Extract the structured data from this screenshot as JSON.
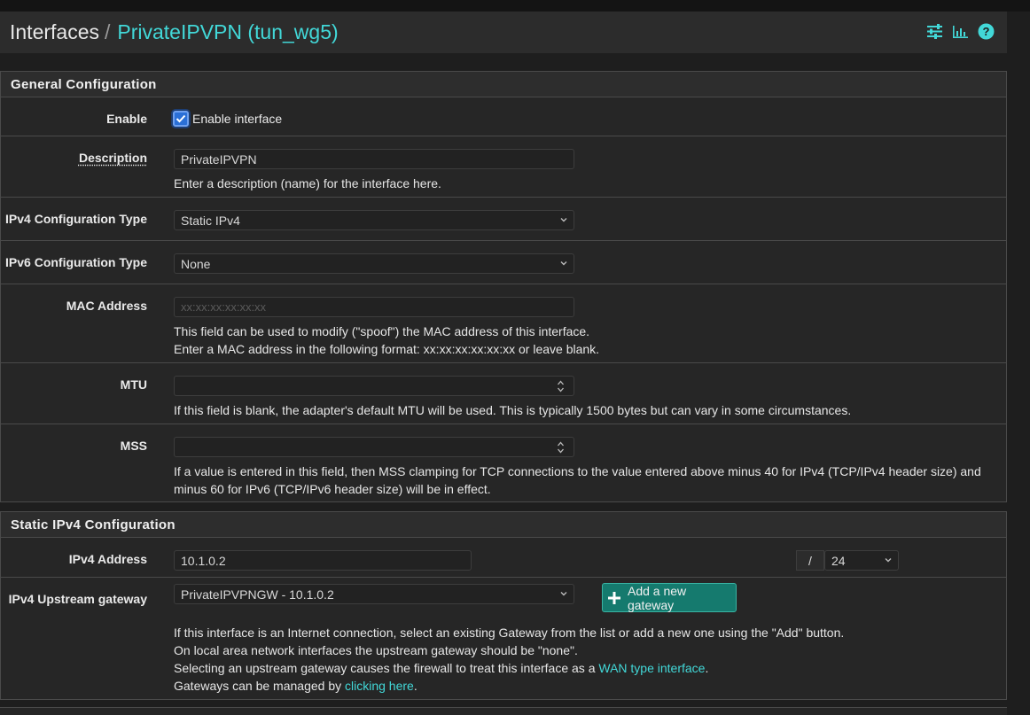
{
  "breadcrumb": {
    "root": "Interfaces",
    "separator": "/",
    "current": "PrivateIPVPN (tun_wg5)"
  },
  "header_icons": [
    "sliders-icon",
    "bar-chart-icon",
    "help-icon"
  ],
  "accent_color": "#42d8d8",
  "general": {
    "title": "General Configuration",
    "enable": {
      "label": "Enable",
      "checkbox_label": "Enable interface",
      "checked": true
    },
    "description": {
      "label": "Description",
      "value": "PrivateIPVPN",
      "help": "Enter a description (name) for the interface here."
    },
    "ipv4_type": {
      "label": "IPv4 Configuration Type",
      "value": "Static IPv4"
    },
    "ipv6_type": {
      "label": "IPv6 Configuration Type",
      "value": "None"
    },
    "mac": {
      "label": "MAC Address",
      "placeholder": "xx:xx:xx:xx:xx:xx",
      "help1": "This field can be used to modify (\"spoof\") the MAC address of this interface.",
      "help2": "Enter a MAC address in the following format: xx:xx:xx:xx:xx:xx or leave blank."
    },
    "mtu": {
      "label": "MTU",
      "value": "",
      "help": "If this field is blank, the adapter's default MTU will be used. This is typically 1500 bytes but can vary in some circumstances."
    },
    "mss": {
      "label": "MSS",
      "value": "",
      "help1": "If a value is entered in this field, then MSS clamping for TCP connections to the value entered above minus 40 for IPv4 (TCP/IPv4 header size) and",
      "help2": "minus 60 for IPv6 (TCP/IPv6 header size) will be in effect."
    }
  },
  "static4": {
    "title": "Static IPv4 Configuration",
    "address": {
      "label": "IPv4 Address",
      "value": "10.1.0.2",
      "slash": "/",
      "cidr": "24"
    },
    "gateway": {
      "label": "IPv4 Upstream gateway",
      "value": "PrivateIPVPNGW - 10.1.0.2",
      "add_button": "Add a new gateway",
      "help1": "If this interface is an Internet connection, select an existing Gateway from the list or add a new one using the \"Add\" button.",
      "help2": "On local area network interfaces the upstream gateway should be \"none\".",
      "help3_pre": "Selecting an upstream gateway causes the firewall to treat this interface as a ",
      "help3_link": "WAN type interface",
      "help3_post": ".",
      "help4_pre": "Gateways can be managed by ",
      "help4_link": "clicking here",
      "help4_post": "."
    }
  }
}
